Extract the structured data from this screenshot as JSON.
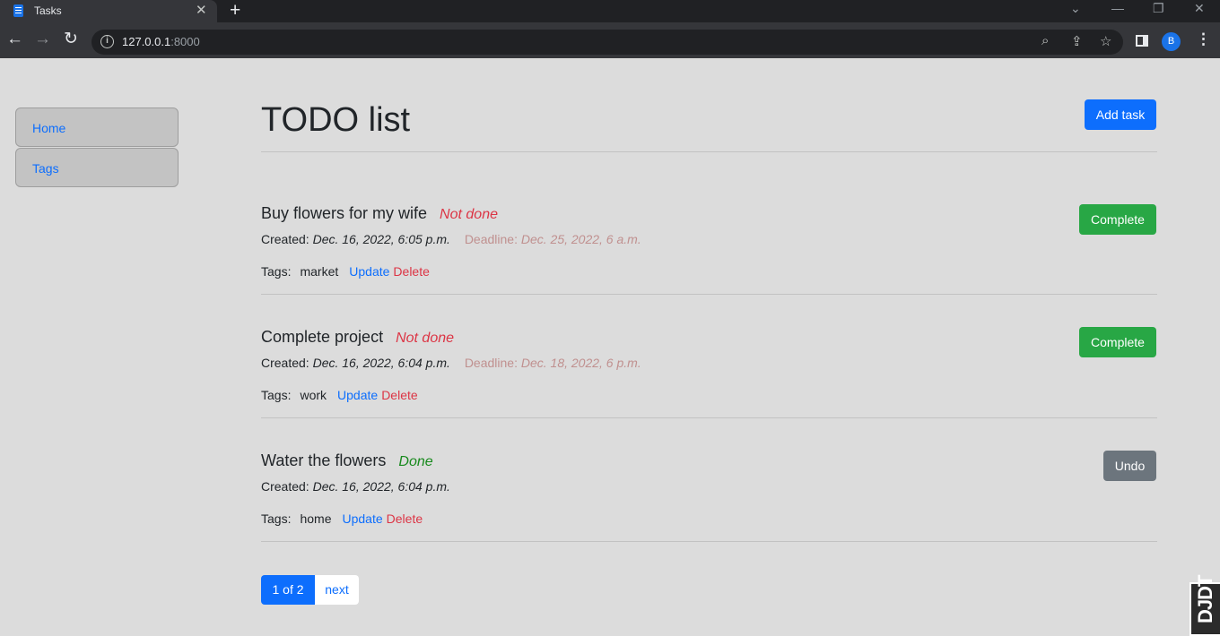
{
  "browser": {
    "tab_title": "Tasks",
    "tab_close": "✕",
    "new_tab": "+",
    "url_host": "127.0.0.1",
    "url_port": ":8000",
    "profile_initial": "B"
  },
  "sidebar": {
    "items": [
      {
        "label": "Home"
      },
      {
        "label": "Tags"
      }
    ]
  },
  "header": {
    "title": "TODO list",
    "add_button": "Add task"
  },
  "tasks": [
    {
      "name": "Buy flowers for my wife",
      "status": "Not done",
      "created_label": "Created:",
      "created": "Dec. 16, 2022, 6:05 p.m.",
      "deadline_label": "Deadline:",
      "deadline": "Dec. 25, 2022, 6 a.m.",
      "tags_label": "Tags:",
      "tags": "market",
      "update": "Update",
      "delete": "Delete",
      "action": "Complete"
    },
    {
      "name": "Complete project",
      "status": "Not done",
      "created_label": "Created:",
      "created": "Dec. 16, 2022, 6:04 p.m.",
      "deadline_label": "Deadline:",
      "deadline": "Dec. 18, 2022, 6 p.m.",
      "tags_label": "Tags:",
      "tags": "work",
      "update": "Update",
      "delete": "Delete",
      "action": "Complete"
    },
    {
      "name": "Water the flowers",
      "status": "Done",
      "created_label": "Created:",
      "created": "Dec. 16, 2022, 6:04 p.m.",
      "tags_label": "Tags:",
      "tags": "home",
      "update": "Update",
      "delete": "Delete",
      "action": "Undo"
    }
  ],
  "pagination": {
    "current": "1 of 2",
    "next": "next"
  },
  "debug_toolbar": {
    "label": "DJDT"
  }
}
